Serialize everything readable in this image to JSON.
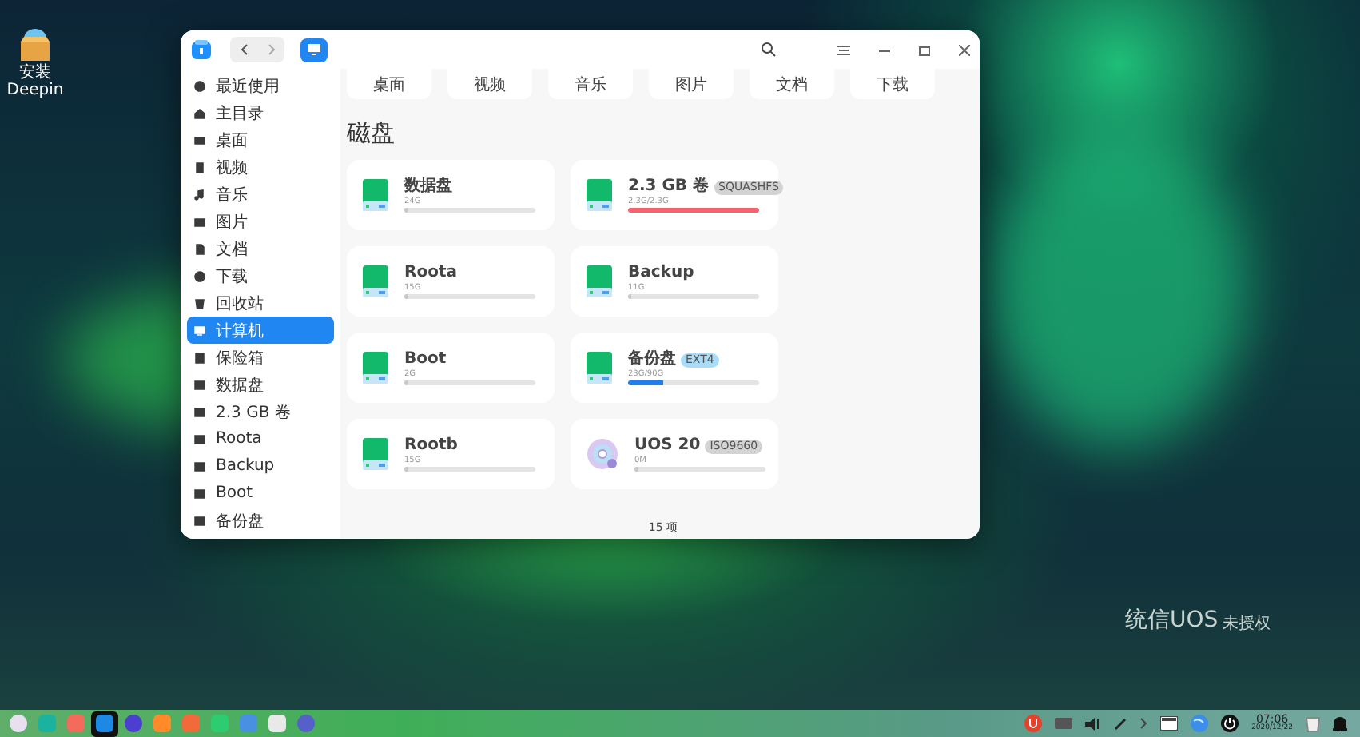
{
  "desktop": {
    "icons": [
      {
        "label": "安装"
      },
      {
        "label": "Deepin"
      }
    ],
    "watermark": {
      "brand": "统信UOS",
      "note": "未授权"
    }
  },
  "window": {
    "quick_access": [
      "桌面",
      "视频",
      "音乐",
      "图片",
      "文档",
      "下载"
    ],
    "sidebar": {
      "items": [
        {
          "label": "最近使用",
          "kind": "recent",
          "selected": false
        },
        {
          "label": "主目录",
          "kind": "home",
          "selected": false
        },
        {
          "label": "桌面",
          "kind": "desktop",
          "selected": false
        },
        {
          "label": "视频",
          "kind": "video",
          "selected": false
        },
        {
          "label": "音乐",
          "kind": "music",
          "selected": false
        },
        {
          "label": "图片",
          "kind": "picture",
          "selected": false
        },
        {
          "label": "文档",
          "kind": "document",
          "selected": false
        },
        {
          "label": "下载",
          "kind": "download",
          "selected": false
        },
        {
          "label": "回收站",
          "kind": "trash",
          "selected": false
        },
        {
          "label": "计算机",
          "kind": "computer",
          "selected": true
        },
        {
          "label": "保险箱",
          "kind": "vault",
          "selected": false
        },
        {
          "label": "数据盘",
          "kind": "disk",
          "selected": false
        },
        {
          "label": "2.3 GB 卷",
          "kind": "disk",
          "selected": false
        },
        {
          "label": "Roota",
          "kind": "disk",
          "selected": false
        },
        {
          "label": "Backup",
          "kind": "disk",
          "selected": false
        },
        {
          "label": "Boot",
          "kind": "disk",
          "selected": false
        },
        {
          "label": "备份盘",
          "kind": "disk",
          "selected": false
        }
      ]
    },
    "section_title": "磁盘",
    "disks": [
      {
        "name": "数据盘",
        "kind": "disk",
        "size": "24G",
        "level": 0
      },
      {
        "name": "2.3 GB 卷",
        "kind": "disk",
        "tag": {
          "text": "SQUASHFS",
          "color": "#d3d3d3"
        },
        "size": "2.3G/2.3G",
        "level": 1
      },
      {
        "name": "Roota",
        "kind": "disk",
        "size": "15G",
        "level": 0
      },
      {
        "name": "Backup",
        "kind": "disk",
        "size": "11G",
        "level": 0
      },
      {
        "name": "Boot",
        "kind": "disk",
        "size": "2G",
        "level": 0
      },
      {
        "name": "备份盘",
        "kind": "disk",
        "tag": {
          "text": "EXT4",
          "color": "#a9dcf7"
        },
        "size": "23G/90G",
        "level": 0.25
      },
      {
        "name": "Rootb",
        "kind": "disk",
        "size": "15G",
        "level": 0
      },
      {
        "name": "UOS 20",
        "kind": "optical",
        "tag": {
          "text": "ISO9660",
          "color": "#d3d3d3"
        },
        "size": "0M",
        "level": 0
      }
    ],
    "status_bar": "15 项"
  },
  "dock": [
    {
      "selected": false
    },
    {
      "selected": false
    },
    {
      "selected": false
    },
    {
      "selected": true
    },
    {
      "selected": false
    },
    {
      "selected": false
    },
    {
      "selected": false
    },
    {
      "selected": false
    },
    {
      "selected": false
    },
    {
      "selected": false
    },
    {
      "selected": false
    }
  ],
  "tray": {
    "time": "07:06",
    "date": "2020/12/22"
  }
}
